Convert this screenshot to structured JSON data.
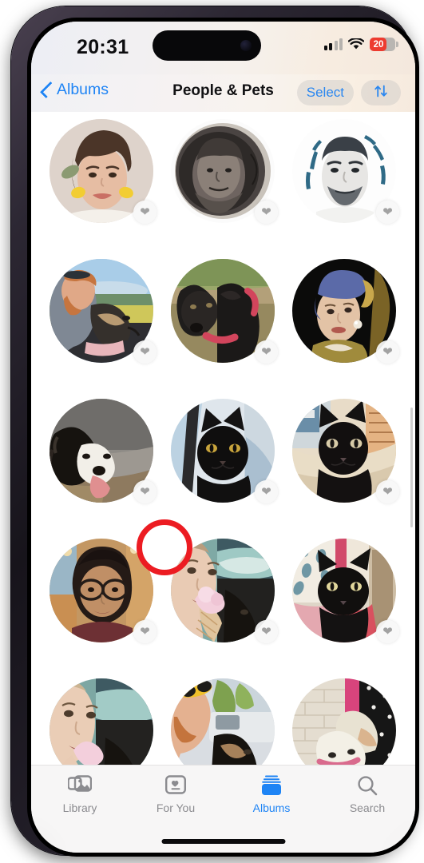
{
  "status_bar": {
    "time": "20:31",
    "cellular_icon": "signal-bars-icon",
    "wifi_icon": "wifi-icon",
    "battery_level": "20",
    "battery_color": "#ed3b2f"
  },
  "nav_bar": {
    "back_label": "Albums",
    "back_icon": "chevron-left-icon",
    "title": "People & Pets",
    "select_label": "Select",
    "sort_icon": "sort-arrows-icon",
    "accent_color": "#1e84f5"
  },
  "grid": {
    "favorite_icon": "heart-icon",
    "rows": [
      {
        "items": [
          {
            "name": "woman-with-yellow-earrings",
            "favorite": true
          },
          {
            "name": "benjamin-franklin-banknote",
            "favorite": true
          },
          {
            "name": "man-portrait-illustration",
            "favorite": true
          }
        ]
      },
      {
        "items": [
          {
            "name": "man-with-dog-in-car",
            "favorite": true
          },
          {
            "name": "black-dog-with-red-collar",
            "favorite": true
          },
          {
            "name": "girl-with-pearl-earring-painting",
            "favorite": true
          }
        ]
      },
      {
        "items": [
          {
            "name": "black-and-white-dog-panting",
            "favorite": true
          },
          {
            "name": "black-cat-on-chair",
            "favorite": true
          },
          {
            "name": "black-cat-on-scratching-post",
            "favorite": true
          }
        ]
      },
      {
        "items": [
          {
            "name": "woman-with-glasses",
            "favorite": true
          },
          {
            "name": "woman-eating-ice-cream",
            "favorite": true
          },
          {
            "name": "black-kitten-held",
            "favorite": true
          }
        ]
      },
      {
        "items": [
          {
            "name": "woman-eating-ice-cream-partial",
            "favorite": false
          },
          {
            "name": "man-with-sunglasses-and-dog",
            "favorite": false
          },
          {
            "name": "white-dog-held-by-person",
            "favorite": false
          }
        ]
      }
    ]
  },
  "annotation": {
    "shape": "circle-highlight",
    "color": "#ec1c22",
    "target": "favorite-heart-badge-row3-col1"
  },
  "tab_bar": {
    "items": [
      {
        "label": "Library",
        "icon": "photo-stack-icon",
        "active": false
      },
      {
        "label": "For You",
        "icon": "for-you-card-icon",
        "active": false
      },
      {
        "label": "Albums",
        "icon": "albums-stack-icon",
        "active": true
      },
      {
        "label": "Search",
        "icon": "magnifier-icon",
        "active": false
      }
    ],
    "active_color": "#1e84f5",
    "inactive_color": "#8b8b8f"
  }
}
